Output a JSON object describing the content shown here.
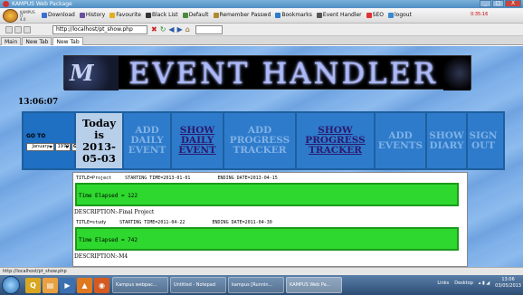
{
  "window": {
    "title": "KAMPUS Web Package",
    "controls": [
      "_",
      "□",
      "X"
    ]
  },
  "toolbar": {
    "brand": [
      "KAMPUS",
      "IT",
      "4.0"
    ],
    "items": [
      "Download",
      "History",
      "Favourite",
      "Black List",
      "Default",
      "Remember Passwd",
      "Bookmarks",
      "Event Handler",
      "SEO",
      "logout"
    ],
    "time": "0:35:16"
  },
  "nav": {
    "url": "http://localhost/pt_show.php",
    "buttons": [
      "✖",
      "↻",
      "◀",
      "▶",
      "⌂"
    ]
  },
  "tabs": [
    "Main",
    "New Tab",
    "New Tab"
  ],
  "page": {
    "banner_title": "EVENT HANDLER",
    "time": "13:06:07",
    "goto": {
      "label": "GO TO",
      "month": "January",
      "year": "1970",
      "button": "GO!"
    },
    "today": "Today is 2013-05-03",
    "menu": [
      {
        "label": "ADD DAILY EVENT",
        "enabled": false
      },
      {
        "label": "SHOW DAILY EVENT",
        "enabled": true
      },
      {
        "label": "ADD PROGRESS TRACKER",
        "enabled": false
      },
      {
        "label": "SHOW PROGRESS TRACKER",
        "enabled": true
      },
      {
        "label": "ADD EVENTS",
        "enabled": false
      },
      {
        "label": "SHOW DIARY",
        "enabled": false
      },
      {
        "label": "SIGN OUT",
        "enabled": false
      }
    ],
    "events": [
      {
        "header": "TITLE=Project     STARTING TIME=2013-01-01          ENDING DATE=2013-04-15",
        "elapsed": "Time Elapsed = 122",
        "description": "DESCRIPTION:-Final Project"
      },
      {
        "header": "TITLE=study     STARTING TIME=2011-04-22          ENDING DATE=2011-04-30",
        "elapsed": "Time Elapsed = 742",
        "description": "DESCRIPTION:-M4"
      }
    ]
  },
  "status": "http://localhost/pt_show.php",
  "taskbar": {
    "tasks": [
      "Kampus webpac...",
      "Untitled - Notepad",
      "kampus [Runnin...",
      "KAMPUS Web Pa..."
    ],
    "tray": {
      "links": "Links",
      "desktop": "Desktop",
      "time": "13:06",
      "date": "03/05/2013"
    }
  },
  "colors": {
    "menu_bg": "#2f7bcb",
    "bar_green": "#2ed82e",
    "disabled_text": "#7fb2e6",
    "banner_text": "#a9b8ff"
  }
}
